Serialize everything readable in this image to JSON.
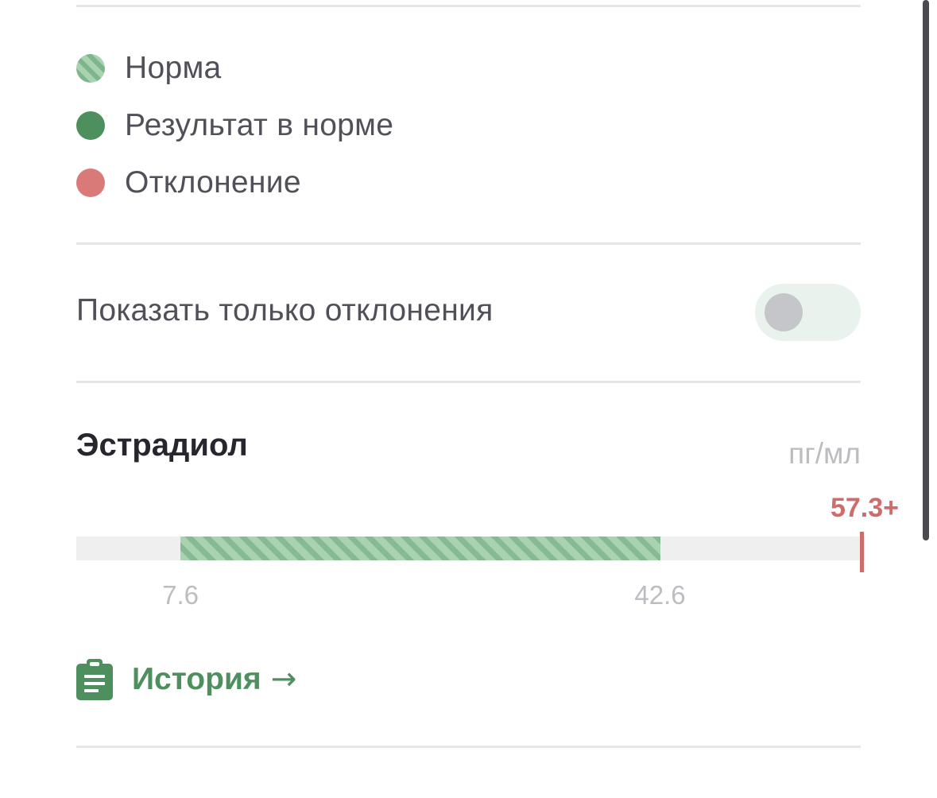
{
  "legend": {
    "items": [
      {
        "label": "Норма",
        "color": "#7fb58c"
      },
      {
        "label": "Результат в норме",
        "color": "#4e8f5e"
      },
      {
        "label": "Отклонение",
        "color": "#d97a78"
      }
    ]
  },
  "filter": {
    "label": "Показать только отклонения",
    "enabled": false
  },
  "analyte": {
    "name": "Эстрадиол",
    "unit": "пг/мл",
    "result_label": "57.3+",
    "norm_low_label": "7.6",
    "norm_high_label": "42.6",
    "norm_low": 7.6,
    "norm_high": 42.6,
    "result_value": 57.3,
    "scale_min": 0,
    "scale_max": 57.3
  },
  "history": {
    "label": "История",
    "arrow": "→",
    "icon": "clipboard-icon"
  },
  "colors": {
    "accent_green": "#4e8f5e",
    "deviation_red": "#cd6d6b",
    "norm_stripe_light": "#a9d2b1",
    "norm_stripe_dark": "#86ba93"
  }
}
